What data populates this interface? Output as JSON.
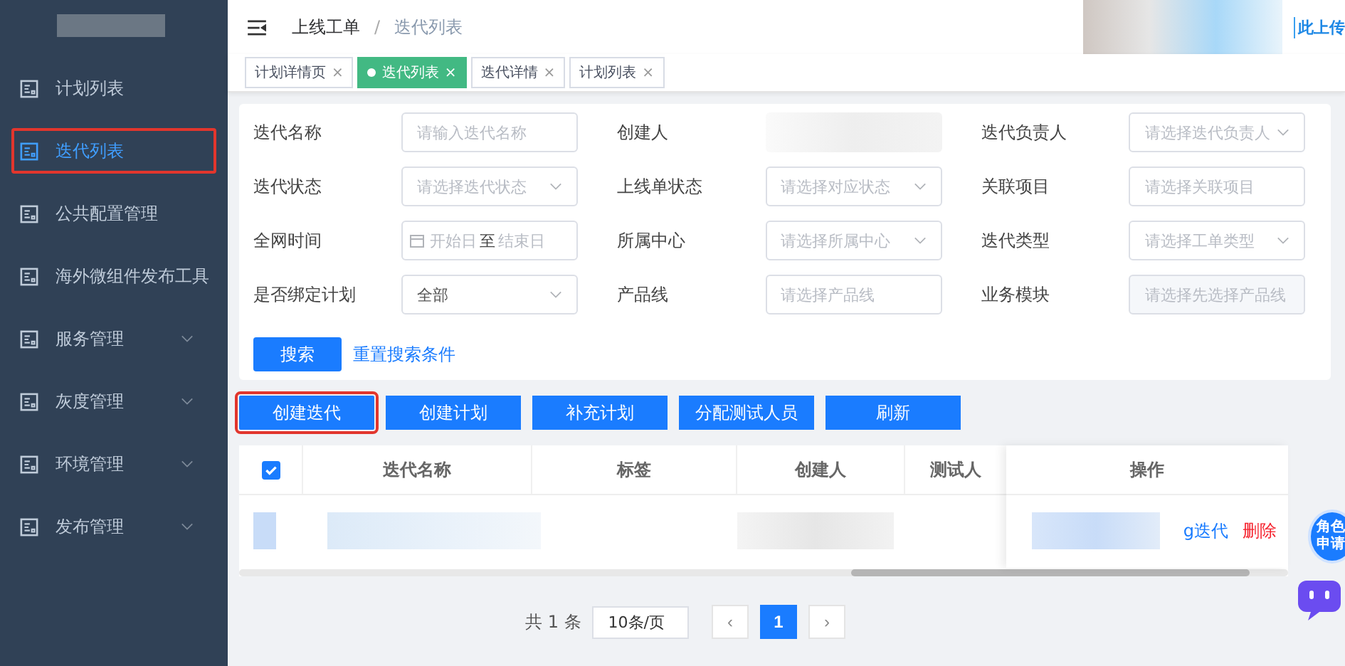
{
  "sidebar": {
    "items": [
      {
        "label": "计划列表",
        "selected": false,
        "outlined": false,
        "kind": "link"
      },
      {
        "label": "迭代列表",
        "selected": true,
        "outlined": true,
        "kind": "link"
      },
      {
        "label": "公共配置管理",
        "selected": false,
        "outlined": false,
        "kind": "link"
      },
      {
        "label": "海外微组件发布工具",
        "selected": false,
        "outlined": false,
        "kind": "link"
      },
      {
        "label": "服务管理",
        "selected": false,
        "outlined": false,
        "kind": "group"
      },
      {
        "label": "灰度管理",
        "selected": false,
        "outlined": false,
        "kind": "group"
      },
      {
        "label": "环境管理",
        "selected": false,
        "outlined": false,
        "kind": "group"
      },
      {
        "label": "发布管理",
        "selected": false,
        "outlined": false,
        "kind": "group"
      }
    ]
  },
  "breadcrumb": [
    "上线工单",
    "迭代列表"
  ],
  "breadcrumb_separator": "/",
  "header_link": "此上传",
  "tabs": [
    {
      "label": "计划详情页",
      "selected": false,
      "close": "×"
    },
    {
      "label": "迭代列表",
      "selected": true,
      "close": "×"
    },
    {
      "label": "迭代详情",
      "selected": false,
      "close": "×"
    },
    {
      "label": "计划列表",
      "selected": false,
      "close": "×"
    }
  ],
  "filters": [
    {
      "label": "迭代名称",
      "kind": "input",
      "placeholder": "请输入迭代名称"
    },
    {
      "label": "创建人",
      "kind": "hidden"
    },
    {
      "label": "迭代负责人",
      "kind": "select",
      "placeholder": "请选择迭代负责人"
    },
    {
      "label": "迭代状态",
      "kind": "select",
      "placeholder": "请选择迭代状态"
    },
    {
      "label": "上线单状态",
      "kind": "select",
      "placeholder": "请选择对应状态"
    },
    {
      "label": "关联项目",
      "kind": "input",
      "placeholder": "请选择关联项目"
    },
    {
      "label": "全网时间",
      "kind": "daterange",
      "start": "开始日",
      "sep": "至",
      "end": "结束日"
    },
    {
      "label": "所属中心",
      "kind": "select",
      "placeholder": "请选择所属中心"
    },
    {
      "label": "迭代类型",
      "kind": "select",
      "placeholder": "请选择工单类型"
    },
    {
      "label": "是否绑定计划",
      "kind": "select",
      "value": "全部"
    },
    {
      "label": "产品线",
      "kind": "input",
      "placeholder": "请选择产品线"
    },
    {
      "label": "业务模块",
      "kind": "disabled",
      "placeholder": "请选择先选择产品线"
    }
  ],
  "search_button": "搜索",
  "reset_link": "重置搜索条件",
  "actions": [
    {
      "label": "创建迭代",
      "outlined": true
    },
    {
      "label": "创建计划",
      "outlined": false
    },
    {
      "label": "补充计划",
      "outlined": false
    },
    {
      "label": "分配测试人员",
      "outlined": false
    },
    {
      "label": "刷新",
      "outlined": false
    }
  ],
  "table": {
    "select_all": {
      "checked": true
    },
    "columns": [
      "迭代名称",
      "标签",
      "创建人",
      "测试人"
    ],
    "action_column": "操作",
    "rows": [
      {
        "actions": [
          {
            "label": "g迭代",
            "kind": "link"
          },
          {
            "label": "删除",
            "kind": "danger"
          }
        ]
      }
    ]
  },
  "pagination": {
    "total": "共 1 条",
    "page_size": "10条/页",
    "prev": "‹",
    "pages": [
      {
        "label": "1",
        "selected": true
      }
    ],
    "next": "›"
  },
  "floating": {
    "badge": "角色申请"
  }
}
